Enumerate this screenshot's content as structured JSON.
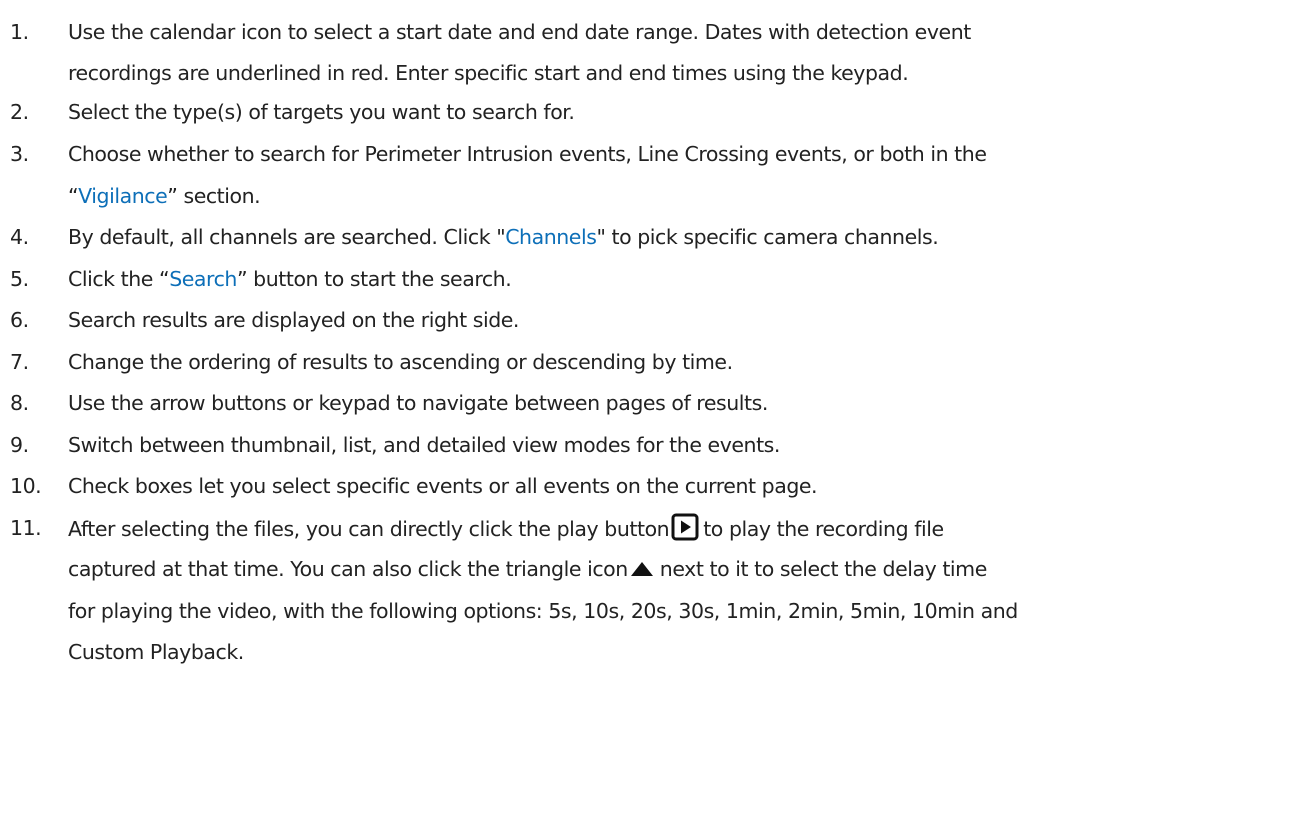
{
  "items": [
    {
      "number": "1.",
      "lines": [
        "Use the calendar icon to select a start date and end date range. Dates with detection event",
        "recordings are underlined in red. Enter specific start and end times using the keypad."
      ]
    },
    {
      "number": "2.",
      "lines": [
        "Select the type(s) of targets you want to search for."
      ]
    },
    {
      "number": "3.",
      "line1": "Choose whether to search for Perimeter Intrusion events, Line Crossing events, or both in the",
      "line2_quote_open": " “",
      "line2_highlight": "Vigilance",
      "line2_after": "”  section."
    },
    {
      "number": "4.",
      "before": "By default, all channels are searched. Click \"",
      "highlight": "Channels",
      "after": "\" to pick specific camera channels."
    },
    {
      "number": "5.",
      "before": "Click the  “",
      "highlight": "Search",
      "after": "”  button to start the search."
    },
    {
      "number": "6.",
      "lines": [
        "Search results are displayed on the right side."
      ]
    },
    {
      "number": "7.",
      "lines": [
        "Change the ordering of results to ascending or descending by time."
      ]
    },
    {
      "number": "8.",
      "lines": [
        "Use the arrow buttons or keypad to navigate between pages of results."
      ]
    },
    {
      "number": "9.",
      "lines": [
        "Switch between thumbnail, list, and detailed view modes for the events."
      ]
    },
    {
      "number": "10.",
      "lines": [
        "Check boxes let you select specific events or all events on the current page."
      ]
    },
    {
      "number": "11.",
      "line1_before": "After selecting the files, you can directly click the play button",
      "line1_after": "to play the recording file",
      "line2_before": "captured at that time. You can also click the triangle icon",
      "line2_after": "next to it to select the delay time",
      "line3": "for playing the video, with the following options: 5s, 10s, 20s, 30s, 1min, 2min, 5min, 10min and",
      "line4": "Custom Playback."
    }
  ],
  "icons": {
    "play": "play-button-icon",
    "triangle": "triangle-up-icon"
  },
  "colors": {
    "text": "#222222",
    "highlight": "#0d6fb8",
    "icon": "#111111"
  }
}
